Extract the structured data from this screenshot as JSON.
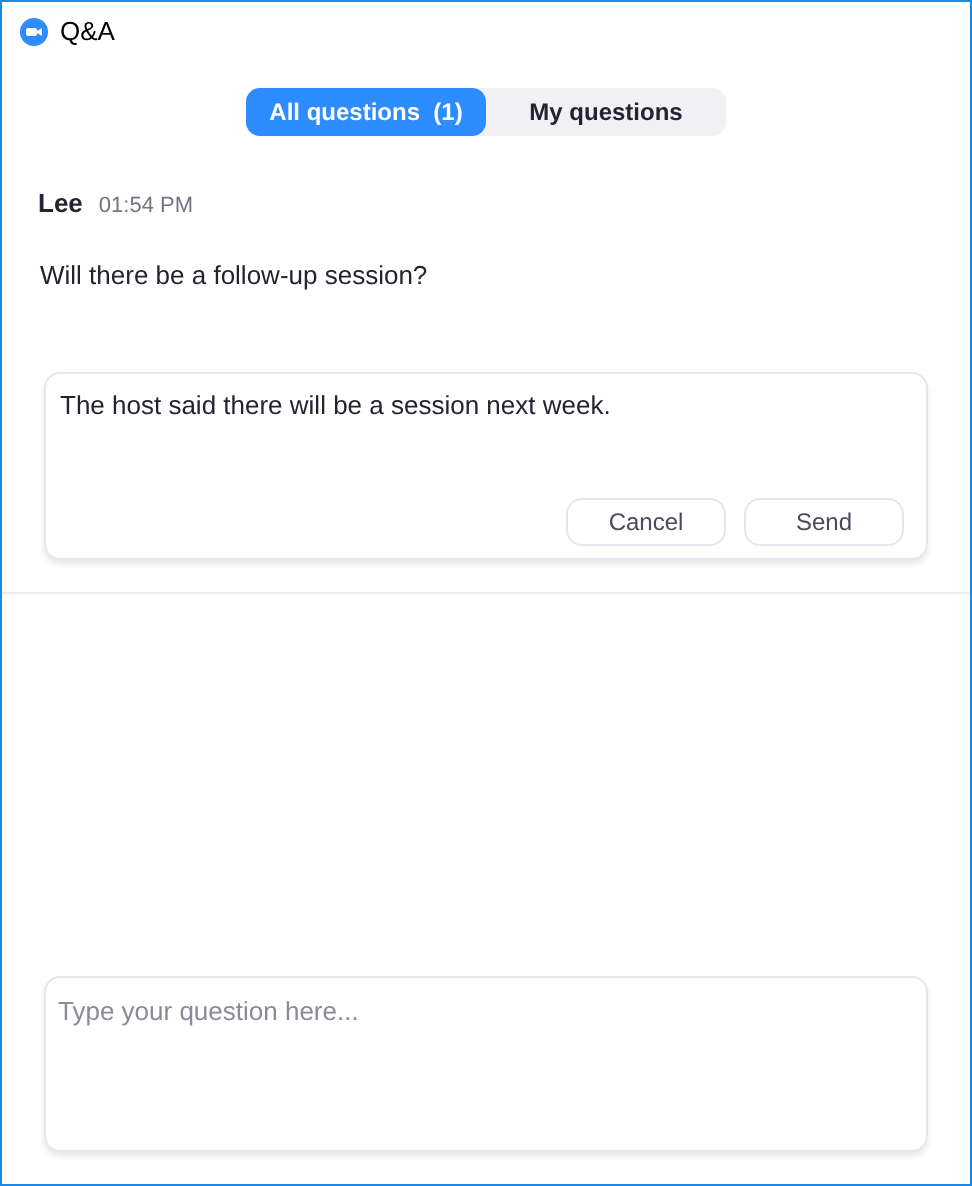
{
  "window": {
    "title": "Q&A"
  },
  "tabs": [
    {
      "label": "All questions  (1)",
      "selected": true
    },
    {
      "label": "My questions",
      "selected": false
    }
  ],
  "question": {
    "author": "Lee",
    "time": "01:54 PM",
    "text": "Will there be a follow-up session?"
  },
  "reply": {
    "value": "The host said there will be a session next week.",
    "buttons": [
      "Cancel",
      "Send"
    ]
  },
  "ask": {
    "placeholder": "Type your question here..."
  }
}
